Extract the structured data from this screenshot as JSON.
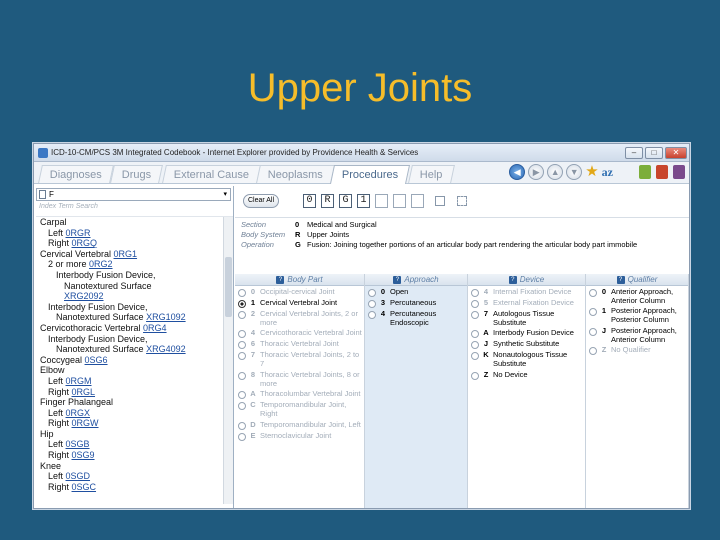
{
  "slide": {
    "title": "Upper Joints"
  },
  "window": {
    "title": "ICD-10-CM/PCS 3M Integrated Codebook - Internet Explorer provided by Providence Health & Services",
    "min": "–",
    "max": "□",
    "close": "✕"
  },
  "tabs": [
    "Diagnoses",
    "Drugs",
    "External Cause",
    "Neoplasms",
    "Procedures",
    "Help"
  ],
  "active_tab": "Procedures",
  "nav": {
    "back": "◀",
    "fwd": "▶",
    "up": "▲",
    "down": "▼",
    "star": "★",
    "az": "az"
  },
  "left": {
    "select_value": "F",
    "select_arrow": "▾",
    "search_placeholder": "Index Term Search",
    "tree": [
      {
        "t": "Carpal",
        "c": "",
        "i": 1
      },
      {
        "t": "Left ",
        "c": "0RGR",
        "i": 2
      },
      {
        "t": "Right ",
        "c": "0RGQ",
        "i": 2
      },
      {
        "t": "Cervical Vertebral ",
        "c": "0RG1",
        "i": 1
      },
      {
        "t": "2 or more ",
        "c": "0RG2",
        "i": 2
      },
      {
        "t": "Interbody Fusion Device,",
        "c": "",
        "i": 3
      },
      {
        "t": "Nanotextured Surface",
        "c": "",
        "i": 4
      },
      {
        "t": "",
        "c": "XRG2092",
        "i": 4
      },
      {
        "t": "Interbody Fusion Device,",
        "c": "",
        "i": 2
      },
      {
        "t": "Nanotextured Surface ",
        "c": "XRG1092",
        "i": 3
      },
      {
        "t": "Cervicothoracic Vertebral ",
        "c": "0RG4",
        "i": 1
      },
      {
        "t": "Interbody Fusion Device,",
        "c": "",
        "i": 2
      },
      {
        "t": "Nanotextured Surface ",
        "c": "XRG4092",
        "i": 3
      },
      {
        "t": "Coccygeal ",
        "c": "0SG6",
        "i": 1
      },
      {
        "t": "Elbow",
        "c": "",
        "i": 1
      },
      {
        "t": "Left ",
        "c": "0RGM",
        "i": 2
      },
      {
        "t": "Right ",
        "c": "0RGL",
        "i": 2
      },
      {
        "t": "Finger Phalangeal",
        "c": "",
        "i": 1
      },
      {
        "t": "Left ",
        "c": "0RGX",
        "i": 2
      },
      {
        "t": "Right ",
        "c": "0RGW",
        "i": 2
      },
      {
        "t": "Hip",
        "c": "",
        "i": 1
      },
      {
        "t": "Left ",
        "c": "0SGB",
        "i": 2
      },
      {
        "t": "Right ",
        "c": "0SG9",
        "i": 2
      },
      {
        "t": "Knee",
        "c": "",
        "i": 1
      },
      {
        "t": "Left ",
        "c": "0SGD",
        "i": 2
      },
      {
        "t": "Right ",
        "c": "0SGC",
        "i": 2
      }
    ]
  },
  "toolbar": {
    "clear_all": "Clear All",
    "code": [
      "0",
      "R",
      "G",
      "1",
      "",
      "",
      ""
    ]
  },
  "sbo": [
    {
      "label": "Section",
      "code": "0",
      "value": "Medical and Surgical"
    },
    {
      "label": "Body System",
      "code": "R",
      "value": "Upper Joints"
    },
    {
      "label": "Operation",
      "code": "G",
      "value": "Fusion: Joining together portions of an articular body part rendering the articular body part immobile"
    }
  ],
  "columns": [
    {
      "head": "Body Part",
      "options": [
        {
          "code": "0",
          "text": "Occipital-cervical Joint",
          "state": "dim"
        },
        {
          "code": "1",
          "text": "Cervical Vertebral Joint",
          "state": "selected"
        },
        {
          "code": "2",
          "text": "Cervical Vertebral Joints, 2 or more",
          "state": "dim"
        },
        {
          "code": "4",
          "text": "Cervicothoracic Vertebral Joint",
          "state": "dim"
        },
        {
          "code": "6",
          "text": "Thoracic Vertebral Joint",
          "state": "dim"
        },
        {
          "code": "7",
          "text": "Thoracic Vertebral Joints, 2 to 7",
          "state": "dim"
        },
        {
          "code": "8",
          "text": "Thoracic Vertebral Joints, 8 or more",
          "state": "dim"
        },
        {
          "code": "A",
          "text": "Thoracolumbar Vertebral Joint",
          "state": "dim"
        },
        {
          "code": "C",
          "text": "Temporomandibular Joint, Right",
          "state": "dim"
        },
        {
          "code": "D",
          "text": "Temporomandibular Joint, Left",
          "state": "dim"
        },
        {
          "code": "E",
          "text": "Sternoclavicular Joint",
          "state": "dim"
        }
      ]
    },
    {
      "head": "Approach",
      "options": [
        {
          "code": "0",
          "text": "Open",
          "state": "normal"
        },
        {
          "code": "3",
          "text": "Percutaneous",
          "state": "normal"
        },
        {
          "code": "4",
          "text": "Percutaneous Endoscopic",
          "state": "normal"
        }
      ]
    },
    {
      "head": "Device",
      "options": [
        {
          "code": "4",
          "text": "Internal Fixation Device",
          "state": "dim"
        },
        {
          "code": "5",
          "text": "External Fixation Device",
          "state": "dim"
        },
        {
          "code": "7",
          "text": "Autologous Tissue Substitute",
          "state": "normal"
        },
        {
          "code": "A",
          "text": "Interbody Fusion Device",
          "state": "normal"
        },
        {
          "code": "J",
          "text": "Synthetic Substitute",
          "state": "normal"
        },
        {
          "code": "K",
          "text": "Nonautologous Tissue Substitute",
          "state": "normal"
        },
        {
          "code": "Z",
          "text": "No Device",
          "state": "normal"
        }
      ]
    },
    {
      "head": "Qualifier",
      "options": [
        {
          "code": "0",
          "text": "Anterior Approach, Anterior Column",
          "state": "normal"
        },
        {
          "code": "1",
          "text": "Posterior Approach, Posterior Column",
          "state": "normal"
        },
        {
          "code": "J",
          "text": "Posterior Approach, Anterior Column",
          "state": "normal"
        },
        {
          "code": "Z",
          "text": "No Qualifier",
          "state": "dim"
        }
      ]
    }
  ],
  "colors": {
    "background": "#1f5a7e",
    "title": "#f6bd2a",
    "link": "#1f4fa0"
  }
}
